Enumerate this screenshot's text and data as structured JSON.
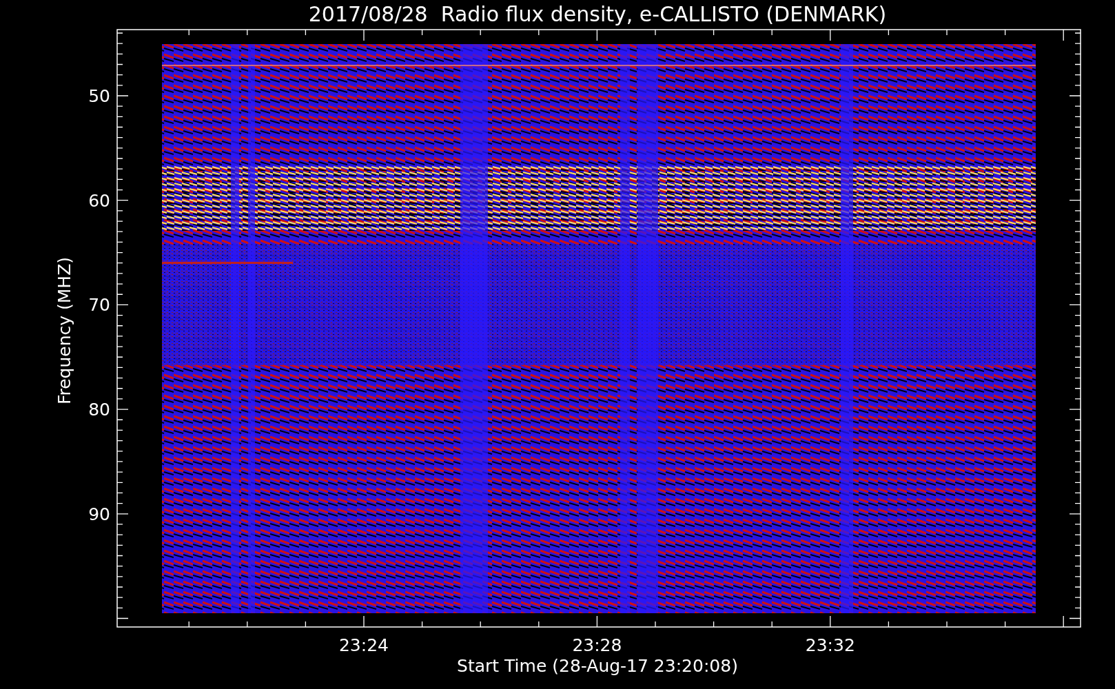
{
  "title": "2017/08/28  Radio flux density, e-CALLISTO (DENMARK)",
  "y_axis": {
    "label": "Frequency (MHZ)",
    "ticks": [
      "50",
      "60",
      "70",
      "80",
      "90"
    ]
  },
  "x_axis": {
    "label": "Start Time (28-Aug-17 23:20:08)",
    "ticks": [
      "23:24",
      "23:28",
      "23:32"
    ]
  }
}
